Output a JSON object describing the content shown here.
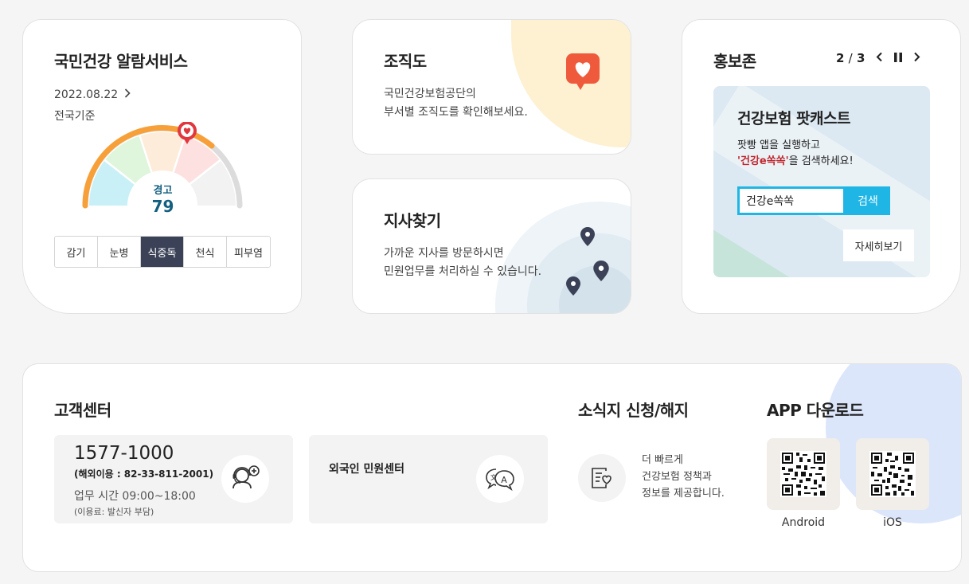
{
  "alarm": {
    "title": "국민건강 알람서비스",
    "date": "2022.08.22",
    "region": "전국기준",
    "status_label": "경고",
    "status_value": "79",
    "tabs": [
      "감기",
      "눈병",
      "식중독",
      "천식",
      "피부염"
    ],
    "active_tab": "식중독"
  },
  "org": {
    "title": "조직도",
    "desc_line1": "국민건강보험공단의",
    "desc_line2": "부서별 조직도를 확인해보세요."
  },
  "branch": {
    "title": "지사찾기",
    "desc_line1": "가까운 지사를 방문하시면",
    "desc_line2": "민원업무를 처리하실 수 있습니다."
  },
  "promo": {
    "title": "홍보존",
    "page_current": "2",
    "page_sep": "/",
    "page_total": "3",
    "banner_title": "건강보험 팟캐스트",
    "banner_line1": "팟빵 앱을 실행하고",
    "banner_highlight": "'건강e쏙쏙'",
    "banner_line2_rest": "을 검색하세요!",
    "search_value": "건강e쏙쏙",
    "search_button": "검색",
    "more_button": "자세히보기"
  },
  "customer": {
    "title": "고객센터",
    "phone": "1577-1000",
    "overseas": "(해외이용 : 82-33-811-2001)",
    "hours": "업무 시간 09:00~18:00",
    "fee": "(이용료: 발신자 부담)",
    "foreign_center": "외국인 민원센터"
  },
  "news": {
    "title": "소식지 신청/해지",
    "line1": "더 빠르게",
    "line2": "건강보험 정책과",
    "line3": "정보를 제공합니다."
  },
  "app": {
    "title": "APP 다운로드",
    "android": "Android",
    "ios": "iOS"
  },
  "colors": {
    "gauge_orange": "#f7a03a",
    "active_tab": "#3b4257",
    "search_blue": "#1fb6e5",
    "warning_text": "#135f80",
    "pin_red": "#e0383e"
  }
}
